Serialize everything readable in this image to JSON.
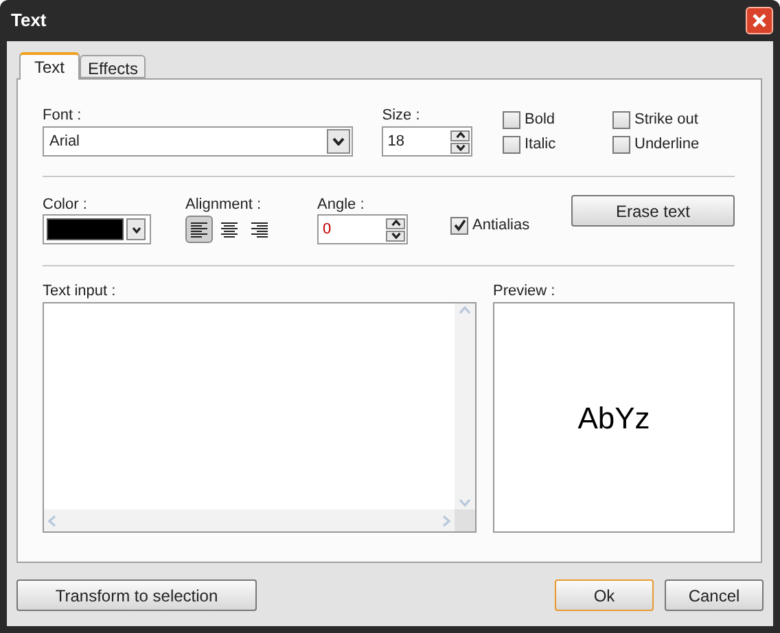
{
  "window": {
    "title": "Text"
  },
  "tabs": [
    {
      "label": "Text",
      "selected": true
    },
    {
      "label": "Effects",
      "selected": false
    }
  ],
  "font": {
    "label": "Font :",
    "value": "Arial"
  },
  "size": {
    "label": "Size :",
    "value": "18"
  },
  "styles": [
    {
      "label": "Bold",
      "checked": false
    },
    {
      "label": "Strike out",
      "checked": false
    },
    {
      "label": "Italic",
      "checked": false
    },
    {
      "label": "Underline",
      "checked": false
    }
  ],
  "color": {
    "label": "Color :",
    "color": "#000000"
  },
  "alignment": {
    "label": "Alignment :",
    "options": [
      {
        "kind": "left",
        "selected": true
      },
      {
        "kind": "center",
        "selected": false
      },
      {
        "kind": "right",
        "selected": false
      }
    ]
  },
  "angle": {
    "label": "Angle :",
    "value": "0"
  },
  "antialias": {
    "label": "Antialias",
    "checked": true
  },
  "erase_button": "Erase text",
  "text_input": {
    "label": "Text input :"
  },
  "preview": {
    "label": "Preview :",
    "sample": "AbYz"
  },
  "buttons": [
    {
      "label": "Transform to selection",
      "kind": "secondary"
    },
    {
      "label": "Ok",
      "kind": "default"
    },
    {
      "label": "Cancel",
      "kind": "secondary"
    }
  ]
}
